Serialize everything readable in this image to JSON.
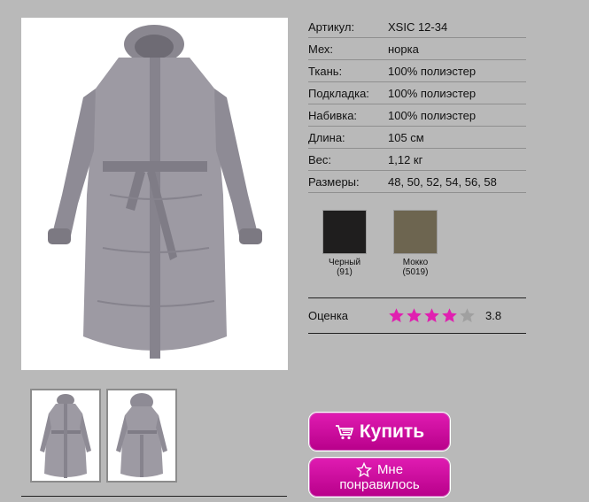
{
  "product": {
    "main_image_alt": "",
    "thumbnails": [
      "front",
      "back"
    ]
  },
  "specs": [
    {
      "label": "Артикул:",
      "value": "XSIC 12-34"
    },
    {
      "label": "Мех:",
      "value": "норка"
    },
    {
      "label": "Ткань:",
      "value": "100% полиэстер"
    },
    {
      "label": "Подкладка:",
      "value": "100% полиэстер"
    },
    {
      "label": "Набивка:",
      "value": "100% полиэстер"
    },
    {
      "label": "Длина:",
      "value": "105 см"
    },
    {
      "label": "Вес:",
      "value": "1,12 кг"
    },
    {
      "label": "Размеры:",
      "value": "48, 50, 52, 54, 56, 58"
    }
  ],
  "colors": [
    {
      "name": "Черный",
      "code": "(91)",
      "hex": "#1f1e1e"
    },
    {
      "name": "Мокко",
      "code": "(5019)",
      "hex": "#6d6550"
    }
  ],
  "rating": {
    "label": "Оценка",
    "value": "3.8",
    "filled_color": "#e020b0",
    "empty_color": "#a0a0a0",
    "stars_filled": 4,
    "stars_total": 5
  },
  "buttons": {
    "buy_label": "Купить",
    "like_line1": "Мне",
    "like_line2": "понравилось"
  },
  "icons": {
    "cart": "cart-icon",
    "star": "star-outline-icon"
  }
}
